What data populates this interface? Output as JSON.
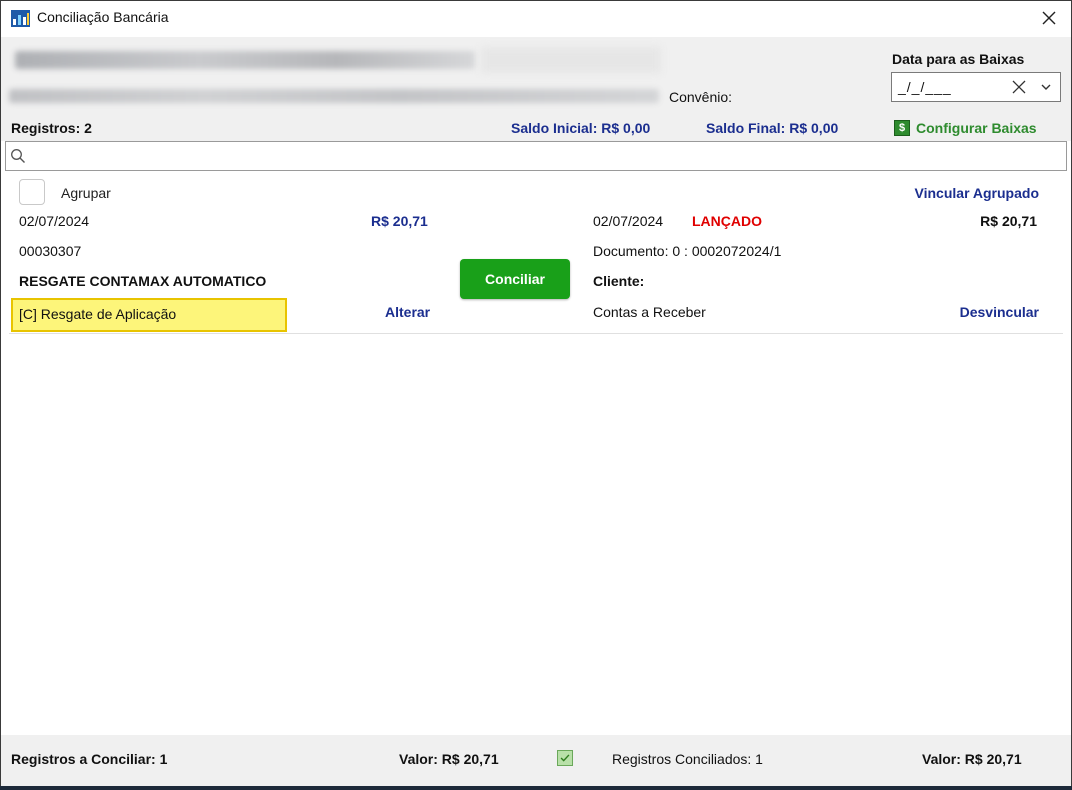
{
  "window": {
    "title": "Conciliação Bancária"
  },
  "header": {
    "convenio_label": "Convênio:",
    "date_label": "Data para as Baixas",
    "date_value": "_/_/___"
  },
  "summary": {
    "registros": "Registros: 2",
    "saldo_inicial": "Saldo Inicial: R$ 0,00",
    "saldo_final": "Saldo Final: R$ 0,00",
    "configurar": "Configurar Baixas",
    "configurar_icon": "$"
  },
  "search": {
    "placeholder": "",
    "value": ""
  },
  "record": {
    "agrupar": "Agrupar",
    "vincular_agrupado": "Vincular Agrupado",
    "left": {
      "date": "02/07/2024",
      "value": "R$ 20,71",
      "code": "00030307",
      "description": "RESGATE CONTAMAX AUTOMATICO",
      "classification": "[C] Resgate de Aplicação",
      "alterar": "Alterar"
    },
    "conciliar": "Conciliar",
    "right": {
      "date": "02/07/2024",
      "status": "LANÇADO",
      "value": "R$ 20,71",
      "documento": "Documento: 0 : 0002072024/1",
      "cliente": "Cliente:",
      "contas": "Contas a Receber",
      "desvincular": "Desvincular"
    }
  },
  "footer": {
    "registros_conciliar": "Registros a Conciliar: 1",
    "valor1": "Valor: R$ 20,71",
    "registros_conciliados": "Registros Conciliados: 1",
    "valor2": "Valor: R$ 20,71"
  },
  "colors": {
    "link_blue": "#1b2e8f",
    "status_red": "#e00000",
    "conciliar_green": "#19a019",
    "configurar_green": "#2e8b2e",
    "highlight_yellow": "#fdf57a"
  },
  "icons": [
    "app-icon",
    "close-icon",
    "clear-date-icon",
    "chevron-down-icon",
    "search-icon",
    "money-icon",
    "check-icon"
  ]
}
